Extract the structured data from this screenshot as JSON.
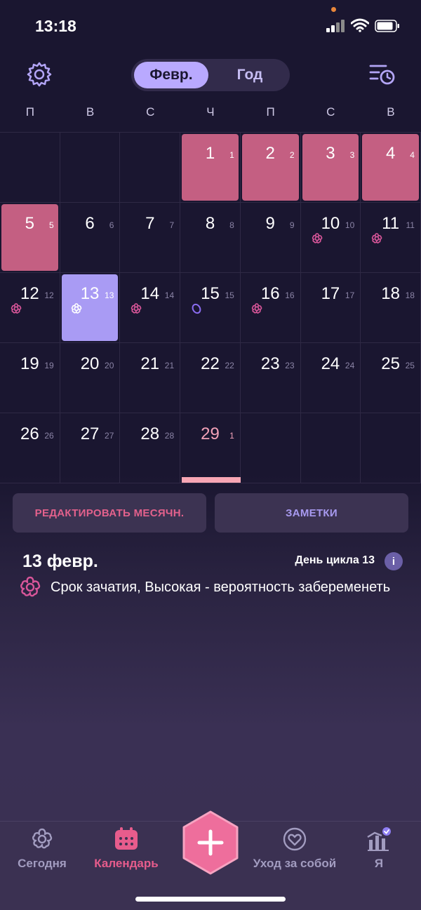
{
  "status": {
    "time": "13:18"
  },
  "header": {
    "segment_month": "Февр.",
    "segment_year": "Год"
  },
  "weekdays": [
    "П",
    "В",
    "С",
    "Ч",
    "П",
    "С",
    "В"
  ],
  "calendar": {
    "rows": [
      [
        null,
        null,
        null,
        {
          "d": "1",
          "c": "1",
          "type": "period"
        },
        {
          "d": "2",
          "c": "2",
          "type": "period"
        },
        {
          "d": "3",
          "c": "3",
          "type": "period"
        },
        {
          "d": "4",
          "c": "4",
          "type": "period"
        }
      ],
      [
        {
          "d": "5",
          "c": "5",
          "type": "period"
        },
        {
          "d": "6",
          "c": "6"
        },
        {
          "d": "7",
          "c": "7"
        },
        {
          "d": "8",
          "c": "8"
        },
        {
          "d": "9",
          "c": "9"
        },
        {
          "d": "10",
          "c": "10",
          "icon": "fertile"
        },
        {
          "d": "11",
          "c": "11",
          "icon": "fertile"
        }
      ],
      [
        {
          "d": "12",
          "c": "12",
          "icon": "fertile"
        },
        {
          "d": "13",
          "c": "13",
          "type": "today",
          "icon": "fertile-white"
        },
        {
          "d": "14",
          "c": "14",
          "icon": "fertile"
        },
        {
          "d": "15",
          "c": "15",
          "icon": "ovulation"
        },
        {
          "d": "16",
          "c": "16",
          "icon": "fertile"
        },
        {
          "d": "17",
          "c": "17"
        },
        {
          "d": "18",
          "c": "18"
        }
      ],
      [
        {
          "d": "19",
          "c": "19"
        },
        {
          "d": "20",
          "c": "20"
        },
        {
          "d": "21",
          "c": "21"
        },
        {
          "d": "22",
          "c": "22"
        },
        {
          "d": "23",
          "c": "23"
        },
        {
          "d": "24",
          "c": "24"
        },
        {
          "d": "25",
          "c": "25"
        }
      ],
      [
        {
          "d": "26",
          "c": "26"
        },
        {
          "d": "27",
          "c": "27"
        },
        {
          "d": "28",
          "c": "28"
        },
        {
          "d": "29",
          "c": "1",
          "type": "future"
        },
        null,
        null,
        null
      ]
    ]
  },
  "actions": {
    "edit_label": "РЕДАКТИРОВАТЬ МЕСЯЧН.",
    "notes_label": "ЗАМЕТКИ"
  },
  "detail": {
    "date": "13 февр.",
    "cycle_day": "День цикла 13",
    "info": "i",
    "note": "Срок зачатия, Высокая - вероятность забеременеть"
  },
  "nav": {
    "today": "Сегодня",
    "calendar": "Календарь",
    "selfcare": "Уход за собой",
    "me": "Я"
  },
  "colors": {
    "background": "#1a1630",
    "period": "#c45f82",
    "today": "#a99bf4",
    "accent_pink": "#e75c8c",
    "accent_purple": "#a89af0"
  }
}
